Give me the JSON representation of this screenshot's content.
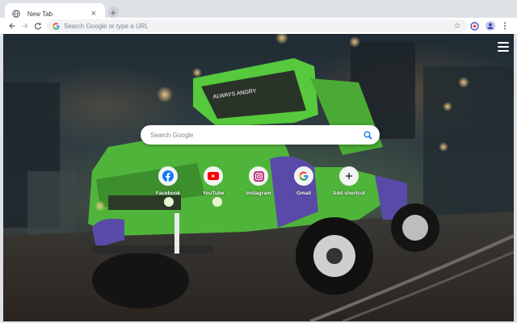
{
  "tab": {
    "title": "New Tab",
    "close": "×"
  },
  "new_tab_button": "+",
  "omnibox": {
    "placeholder": "Search Google or type a URL"
  },
  "search": {
    "placeholder": "Search Google"
  },
  "shortcuts": [
    {
      "label": "Facebook",
      "icon": "facebook-icon"
    },
    {
      "label": "YouTube",
      "icon": "youtube-icon"
    },
    {
      "label": "Instagram",
      "icon": "instagram-icon"
    },
    {
      "label": "Gmail",
      "icon": "google-icon"
    },
    {
      "label": "Add shortcut",
      "icon": "plus-icon"
    }
  ],
  "background": {
    "description_text": "ALWAYS ANGRY"
  },
  "colors": {
    "accent": "#1a73e8",
    "facebook": "#1877f2",
    "youtube": "#ff0000",
    "instagram": "#c13584"
  }
}
